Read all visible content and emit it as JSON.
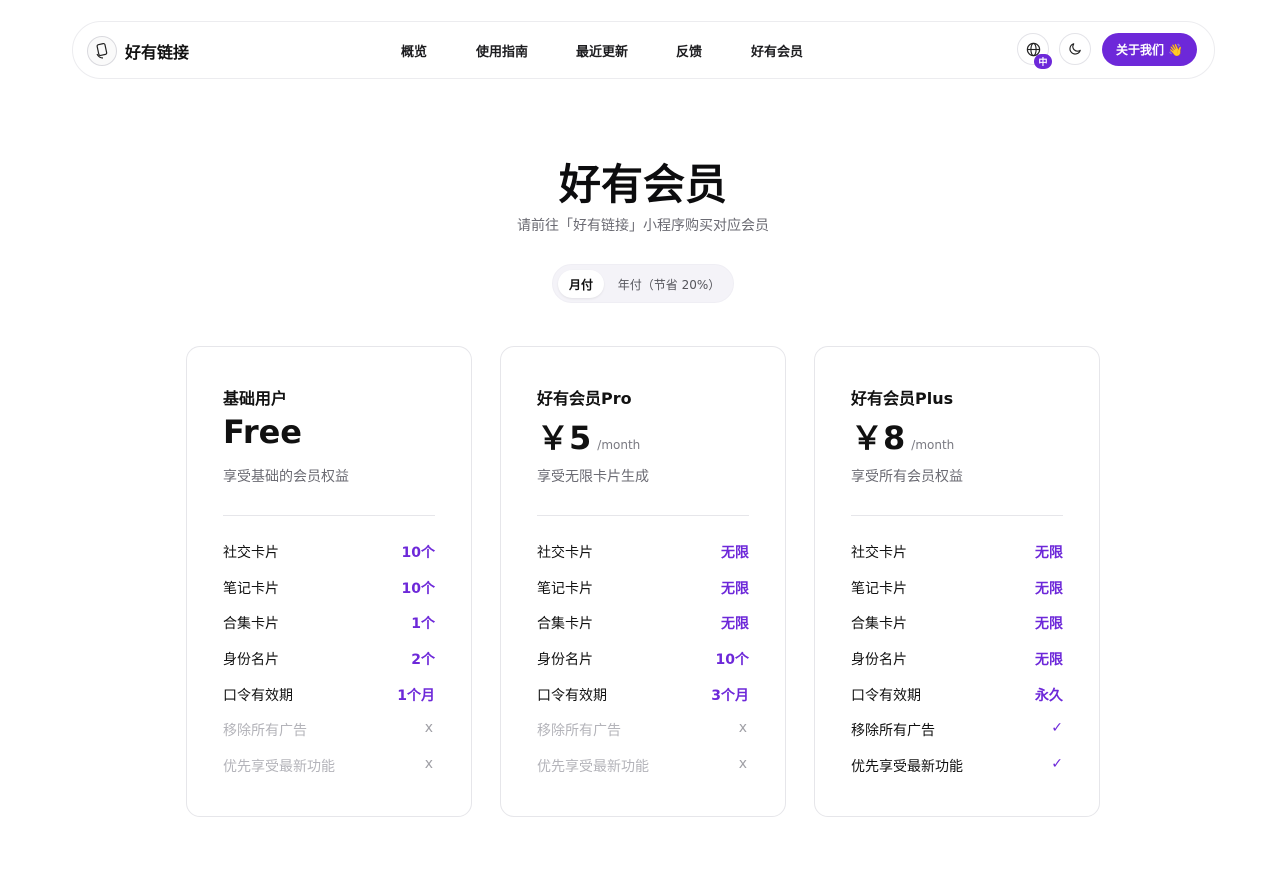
{
  "header": {
    "brand": "好有链接",
    "nav": [
      "概览",
      "使用指南",
      "最近更新",
      "反馈",
      "好有会员"
    ],
    "lang_badge": "中",
    "about_label": "关于我们",
    "about_emoji": "👋"
  },
  "hero": {
    "title": "好有会员",
    "subtitle": "请前往「好有链接」小程序购买对应会员"
  },
  "billing_toggle": {
    "monthly": "月付",
    "yearly": "年付（节省 20%）",
    "selected": "月付"
  },
  "plans": [
    {
      "name": "基础用户",
      "price": "Free",
      "unit": "",
      "desc": "享受基础的会员权益",
      "features": [
        {
          "label": "社交卡片",
          "value": "10个",
          "enabled": true
        },
        {
          "label": "笔记卡片",
          "value": "10个",
          "enabled": true
        },
        {
          "label": "合集卡片",
          "value": "1个",
          "enabled": true
        },
        {
          "label": "身份名片",
          "value": "2个",
          "enabled": true
        },
        {
          "label": "口令有效期",
          "value": "1个月",
          "enabled": true
        },
        {
          "label": "移除所有广告",
          "value": "x",
          "enabled": false
        },
        {
          "label": "优先享受最新功能",
          "value": "x",
          "enabled": false
        }
      ]
    },
    {
      "name": "好有会员Pro",
      "price": "￥5",
      "unit": "/month",
      "desc": "享受无限卡片生成",
      "features": [
        {
          "label": "社交卡片",
          "value": "无限",
          "enabled": true
        },
        {
          "label": "笔记卡片",
          "value": "无限",
          "enabled": true
        },
        {
          "label": "合集卡片",
          "value": "无限",
          "enabled": true
        },
        {
          "label": "身份名片",
          "value": "10个",
          "enabled": true
        },
        {
          "label": "口令有效期",
          "value": "3个月",
          "enabled": true
        },
        {
          "label": "移除所有广告",
          "value": "x",
          "enabled": false
        },
        {
          "label": "优先享受最新功能",
          "value": "x",
          "enabled": false
        }
      ]
    },
    {
      "name": "好有会员Plus",
      "price": "￥8",
      "unit": "/month",
      "desc": "享受所有会员权益",
      "features": [
        {
          "label": "社交卡片",
          "value": "无限",
          "enabled": true
        },
        {
          "label": "笔记卡片",
          "value": "无限",
          "enabled": true
        },
        {
          "label": "合集卡片",
          "value": "无限",
          "enabled": true
        },
        {
          "label": "身份名片",
          "value": "无限",
          "enabled": true
        },
        {
          "label": "口令有效期",
          "value": "永久",
          "enabled": true
        },
        {
          "label": "移除所有广告",
          "value": "✓",
          "enabled": true
        },
        {
          "label": "优先享受最新功能",
          "value": "✓",
          "enabled": true
        }
      ]
    }
  ],
  "colors": {
    "accent": "#6d28d9",
    "text": "#111111",
    "muted": "#6b6b73",
    "disabled": "#b4b4ba",
    "border": "#e6e6ea"
  },
  "icons": {
    "logo": "card-in-hand-logo",
    "language": "globe-icon",
    "theme": "moon-icon"
  }
}
